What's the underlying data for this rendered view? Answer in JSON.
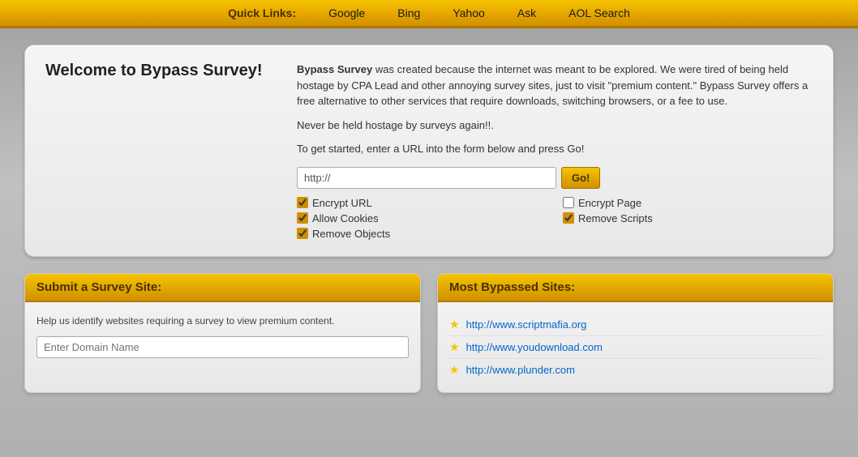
{
  "nav": {
    "label": "Quick Links:",
    "links": [
      {
        "text": "Google",
        "url": "#"
      },
      {
        "text": "Bing",
        "url": "#"
      },
      {
        "text": "Yahoo",
        "url": "#"
      },
      {
        "text": "Ask",
        "url": "#"
      },
      {
        "text": "AOL Search",
        "url": "#"
      }
    ]
  },
  "welcome": {
    "title": "Welcome to Bypass Survey!",
    "intro_brand": "Bypass Survey",
    "intro_text": " was created because the internet was meant to be explored. We were tired of being held hostage by CPA Lead and other annoying survey sites, just to visit \"premium content.\" Bypass Survey offers a free alternative to other services that require downloads, switching browsers, or a fee to use.",
    "tagline": "Never be held hostage by surveys again!!.",
    "cta_text": "To get started, enter a URL into the form below and press Go!",
    "url_placeholder": "http://",
    "go_label": "Go!",
    "checkboxes": [
      {
        "label": "Encrypt URL",
        "checked": true,
        "col": 1
      },
      {
        "label": "Encrypt Page",
        "checked": false,
        "col": 2
      },
      {
        "label": "Allow Cookies",
        "checked": true,
        "col": 1
      },
      {
        "label": "Remove Scripts",
        "checked": true,
        "col": 2
      },
      {
        "label": "Remove Objects",
        "checked": true,
        "col": 1
      }
    ]
  },
  "submit_panel": {
    "title": "Submit a Survey Site:",
    "description": "Help us identify websites requiring a survey to view premium content.",
    "domain_placeholder": "Enter Domain Name"
  },
  "bypassed_panel": {
    "title": "Most Bypassed Sites:",
    "sites": [
      {
        "url": "http://www.scriptmafia.org",
        "label": "http://www.scriptmafia.org"
      },
      {
        "url": "http://www.youdownload.com",
        "label": "http://www.youdownload.com"
      },
      {
        "url": "http://www.plunder.com",
        "label": "http://www.plunder.com"
      }
    ]
  }
}
